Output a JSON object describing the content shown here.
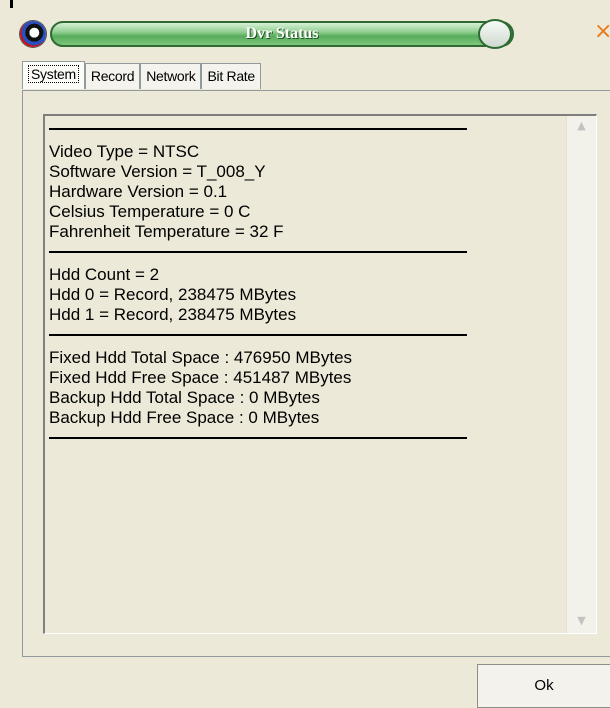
{
  "window": {
    "title": "Dvr Status"
  },
  "tabs": [
    {
      "label": "System",
      "active": true
    },
    {
      "label": "Record",
      "active": false
    },
    {
      "label": "Network",
      "active": false
    },
    {
      "label": "Bit Rate",
      "active": false
    }
  ],
  "system_info": {
    "group1": [
      "Video Type = NTSC",
      "Software Version = T_008_Y",
      "Hardware Version = 0.1",
      "Celsius Temperature = 0 C",
      "Fahrenheit Temperature = 32 F"
    ],
    "group2": [
      "Hdd Count = 2",
      "Hdd 0 = Record, 238475 MBytes",
      "Hdd 1 = Record, 238475 MBytes"
    ],
    "group3": [
      "Fixed Hdd Total Space : 476950 MBytes",
      "Fixed Hdd Free Space : 451487 MBytes",
      "Backup Hdd Total Space : 0 MBytes",
      "Backup Hdd Free Space : 0 MBytes"
    ]
  },
  "buttons": {
    "ok": "Ok"
  },
  "icons": {
    "app": "app-globe-icon",
    "close": "close-icon",
    "scroll_up": "scroll-up-arrow-icon",
    "scroll_down": "scroll-down-arrow-icon"
  },
  "colors": {
    "title_bar": "#57ad5b",
    "close": "#e87a17",
    "background": "#ece9d8"
  }
}
